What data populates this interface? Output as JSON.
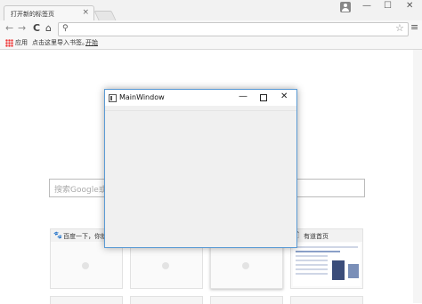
{
  "browser": {
    "tab": {
      "title": "打开新的标签页",
      "close": "×"
    },
    "window_controls": {
      "minimize": "—",
      "maximize": "☐",
      "close": "✕"
    },
    "nav": {
      "back": "←",
      "forward": "→",
      "reload": "C",
      "home": "⌂"
    },
    "omnibox": {
      "search_glyph": "🔍",
      "value": ""
    },
    "star": "☆",
    "menu": "≡",
    "bookmarks": {
      "apps_label": "应用",
      "hint": "点击这里导入书签。",
      "start": "开始"
    }
  },
  "ntp": {
    "search_placeholder": "搜索Google或",
    "tiles": [
      {
        "label": "百度一下，你就",
        "icon": "baidu-paw-icon",
        "glyph": "🐾"
      },
      {
        "label": ""
      },
      {
        "label": ""
      },
      {
        "label": "有道首页",
        "icon": "page-icon",
        "glyph": "🗋"
      }
    ]
  },
  "mainwindow": {
    "title": "MainWindow",
    "minimize": "—",
    "close": "✕"
  },
  "colors": {
    "window_border": "#5b9bd5",
    "chrome_bg": "#f2f2f2",
    "apps_icon": "#e33333"
  }
}
